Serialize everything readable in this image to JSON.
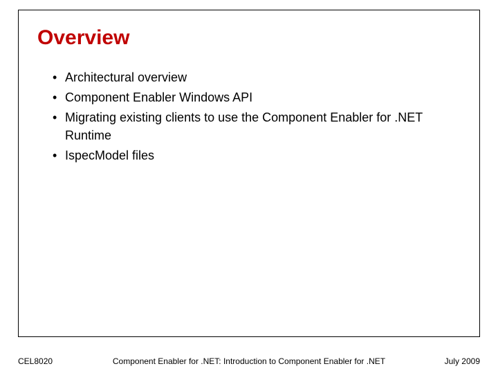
{
  "slide": {
    "title": "Overview",
    "bullets": [
      "Architectural overview",
      "Component Enabler Windows API",
      "Migrating existing clients to use the Component Enabler for .NET Runtime",
      "IspecModel files"
    ]
  },
  "footer": {
    "left": "CEL8020",
    "center": "Component Enabler for .NET: Introduction to Component Enabler for .NET",
    "right": "July 2009"
  }
}
